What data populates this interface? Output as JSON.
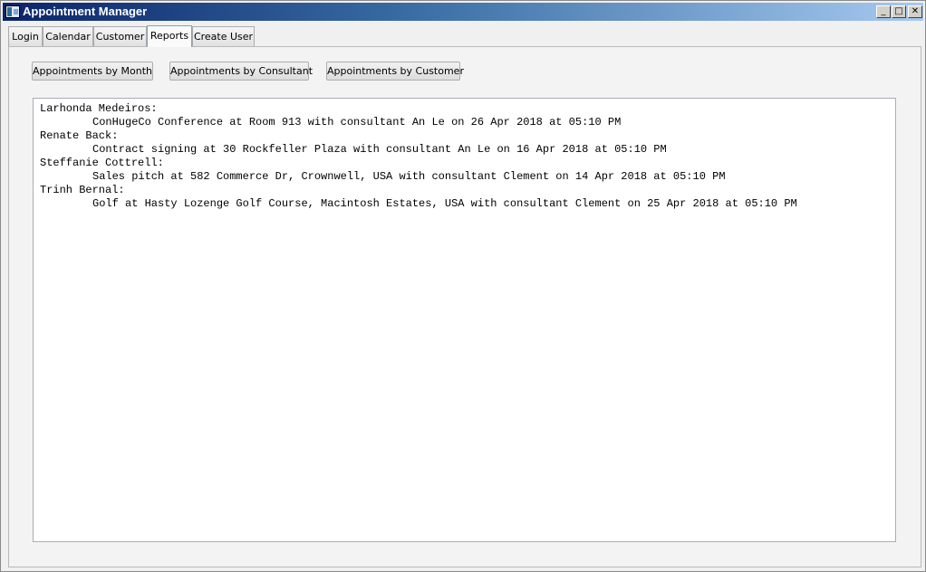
{
  "window": {
    "title": "Appointment Manager",
    "controls": {
      "minimize": "_",
      "maximize": "□",
      "close": "✕"
    }
  },
  "tabs": [
    {
      "label": "Login"
    },
    {
      "label": "Calendar"
    },
    {
      "label": "Customer"
    },
    {
      "label": "Reports",
      "active": true
    },
    {
      "label": "Create User"
    }
  ],
  "reports": {
    "buttons": {
      "by_month": "Appointments by Month",
      "by_consultant": "Appointments by Consultant",
      "by_customer": "Appointments by Customer"
    },
    "output": [
      {
        "customer": "Larhonda Medeiros:",
        "detail": "ConHugeCo Conference at Room 913 with consultant An Le on 26 Apr 2018 at 05:10 PM"
      },
      {
        "customer": "Renate Back:",
        "detail": "Contract signing at 30 Rockfeller Plaza with consultant An Le on 16 Apr 2018 at 05:10 PM"
      },
      {
        "customer": "Steffanie Cottrell:",
        "detail": "Sales pitch at 582 Commerce Dr, Crownwell, USA with consultant Clement on 14 Apr 2018 at 05:10 PM"
      },
      {
        "customer": "Trinh Bernal:",
        "detail": "Golf at Hasty Lozenge Golf Course, Macintosh Estates, USA with consultant Clement on 25 Apr 2018 at 05:10 PM"
      }
    ]
  }
}
